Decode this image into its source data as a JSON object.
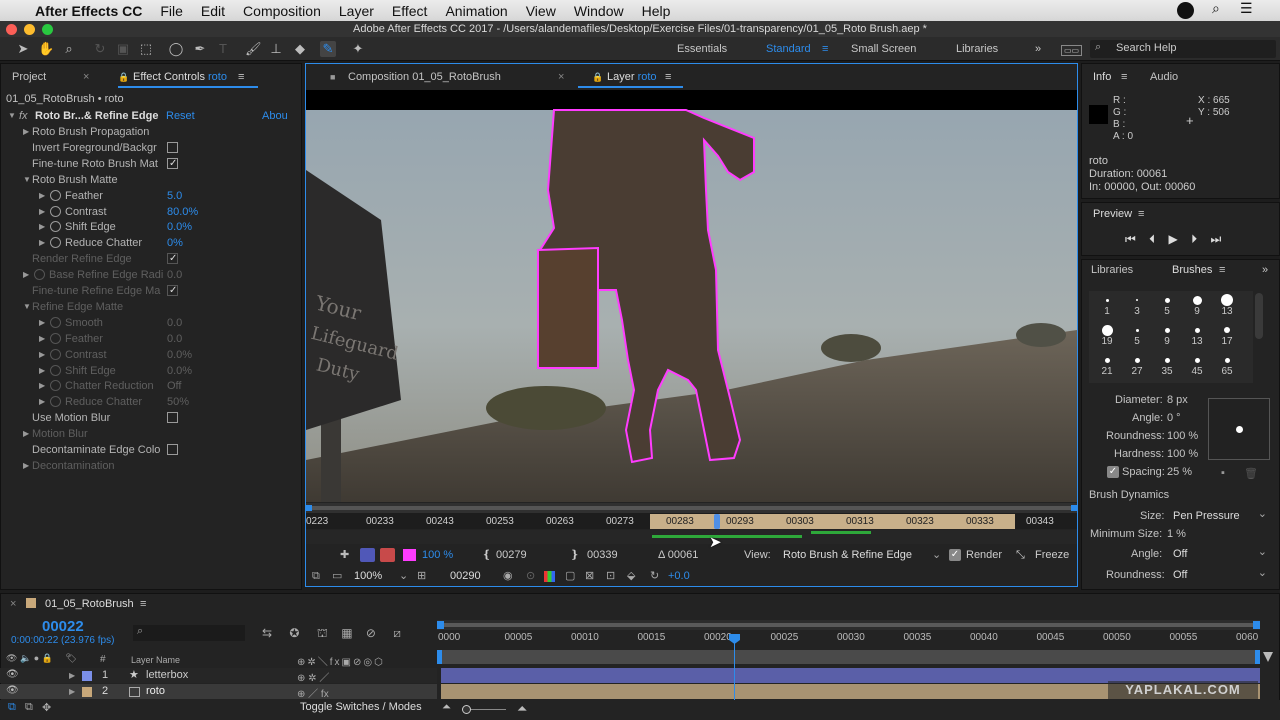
{
  "menu": {
    "apple": "",
    "app": "After Effects CC",
    "items": [
      "File",
      "Edit",
      "Composition",
      "Layer",
      "Effect",
      "Animation",
      "View",
      "Window",
      "Help"
    ]
  },
  "title": "Adobe After Effects CC 2017 - /Users/alandemafiles/Desktop/Exercise Files/01-transparency/01_05_Roto Brush.aep *",
  "workspaces": {
    "essentials": "Essentials",
    "standard": "Standard",
    "small": "Small Screen",
    "libraries": "Libraries",
    "search": "Search Help"
  },
  "left_panel": {
    "tab_project": "Project",
    "tab_effect": "Effect Controls",
    "tab_effect_layer": "roto",
    "subtitle": "01_05_RotoBrush • roto",
    "fx_name": "Roto Br...& Refine Edge",
    "reset": "Reset",
    "about": "Abou",
    "rows": [
      {
        "label": "Roto Brush Propagation",
        "indent": 32,
        "tri": true
      },
      {
        "label": "Invert Foreground/Backgr",
        "indent": 32,
        "cb": "off"
      },
      {
        "label": "Fine-tune Roto Brush Mat",
        "indent": 32,
        "cb": "on"
      },
      {
        "label": "Roto Brush Matte",
        "indent": 32,
        "tri": "open"
      },
      {
        "label": "Feather",
        "indent": 65,
        "tri": true,
        "sw": true,
        "val": "5.0"
      },
      {
        "label": "Contrast",
        "indent": 65,
        "tri": true,
        "sw": true,
        "val": "80.0%"
      },
      {
        "label": "Shift Edge",
        "indent": 65,
        "tri": true,
        "sw": true,
        "val": "0.0%"
      },
      {
        "label": "Reduce Chatter",
        "indent": 65,
        "tri": true,
        "sw": true,
        "val": "0%"
      },
      {
        "label": "Render Refine Edge",
        "indent": 32,
        "cb": "on",
        "dim": true
      },
      {
        "label": "Base Refine Edge Radi",
        "indent": 49,
        "tri": true,
        "sw": true,
        "val": "0.0",
        "dim": true
      },
      {
        "label": "Fine-tune Refine Edge Ma",
        "indent": 32,
        "cb": "on",
        "dim": true
      },
      {
        "label": "Refine Edge Matte",
        "indent": 32,
        "tri": "open",
        "dim": true
      },
      {
        "label": "Smooth",
        "indent": 65,
        "tri": true,
        "sw": true,
        "val": "0.0",
        "dim": true
      },
      {
        "label": "Feather",
        "indent": 65,
        "tri": true,
        "sw": true,
        "val": "0.0",
        "dim": true
      },
      {
        "label": "Contrast",
        "indent": 65,
        "tri": true,
        "sw": true,
        "val": "0.0%",
        "dim": true
      },
      {
        "label": "Shift Edge",
        "indent": 65,
        "tri": true,
        "sw": true,
        "val": "0.0%",
        "dim": true
      },
      {
        "label": "Chatter Reduction",
        "indent": 65,
        "tri": true,
        "sw": true,
        "val": "Off",
        "dim": true
      },
      {
        "label": "Reduce Chatter",
        "indent": 65,
        "tri": true,
        "sw": true,
        "val": "50%",
        "dim": true
      },
      {
        "label": "Use Motion Blur",
        "indent": 32,
        "cb": "off"
      },
      {
        "label": "Motion Blur",
        "indent": 32,
        "tri": true,
        "dim": true
      },
      {
        "label": "Decontaminate Edge Colo",
        "indent": 32,
        "cb": "off"
      },
      {
        "label": "Decontamination",
        "indent": 32,
        "tri": true,
        "dim": true
      }
    ]
  },
  "viewer": {
    "tab_comp": "Composition 01_05_RotoBrush",
    "tab_layer": "Layer",
    "tab_layer_name": "roto",
    "sign_text": "Your\nLifeguard\nDuty",
    "ruler": [
      "0223",
      "00233",
      "00243",
      "00253",
      "00263",
      "00273",
      "00283",
      "00293",
      "00303",
      "00313",
      "00323",
      "00333",
      "00343"
    ],
    "zoom_pct": "100 %",
    "in_point": "00279",
    "out_point": "00339",
    "duration": "Δ 00061",
    "view_label": "View:",
    "view_value": "Roto Brush & Refine Edge",
    "render": "Render",
    "freeze": "Freeze",
    "zoom": "100%",
    "timecode": "00290",
    "exposure": "+0.0"
  },
  "info": {
    "tab_info": "Info",
    "tab_audio": "Audio",
    "r": "R :",
    "g": "G :",
    "b": "B :",
    "a": "A : 0",
    "x": "X : 665",
    "y": "Y : 506",
    "layer": "roto",
    "duration": "Duration: 00061",
    "inout": "In: 00000, Out: 00060"
  },
  "preview": {
    "title": "Preview"
  },
  "brushes": {
    "tab_libraries": "Libraries",
    "tab_brushes": "Brushes",
    "grid": [
      [
        1,
        3,
        5,
        9,
        13
      ],
      [
        19,
        5,
        9,
        13,
        17
      ],
      [
        21,
        27,
        35,
        45,
        65
      ]
    ],
    "diameter_label": "Diameter:",
    "diameter": "8 px",
    "angle_label": "Angle:",
    "angle": "0 °",
    "roundness_label": "Roundness:",
    "roundness": "100 %",
    "hardness_label": "Hardness:",
    "hardness": "100 %",
    "spacing_label": "Spacing:",
    "spacing": "25 %",
    "dynamics": "Brush Dynamics",
    "size_label": "Size:",
    "size": "Pen Pressure",
    "minsize_label": "Minimum Size:",
    "minsize": "1 %",
    "angle2_label": "Angle:",
    "angle2": "Off",
    "round2_label": "Roundness:",
    "round2": "Off"
  },
  "timeline": {
    "tab": "01_05_RotoBrush",
    "current": "00022",
    "timecode": "0:00:00:22 (23.976 fps)",
    "col_num": "#",
    "col_layer": "Layer Name",
    "ruler": [
      "0000",
      "00005",
      "00010",
      "00015",
      "00020",
      "00025",
      "00030",
      "00035",
      "00040",
      "00045",
      "00050",
      "00055",
      "0060"
    ],
    "layers": [
      {
        "num": "1",
        "name": "letterbox"
      },
      {
        "num": "2",
        "name": "roto"
      }
    ],
    "toggle": "Toggle Switches / Modes"
  },
  "watermark": "YAPLAKAL.COM",
  "colors": {
    "accent": "#2d8ceb",
    "roto_outline": "#ff3cff",
    "work_area": "#c8b08a",
    "layer_bar": "#5a5fa8"
  }
}
